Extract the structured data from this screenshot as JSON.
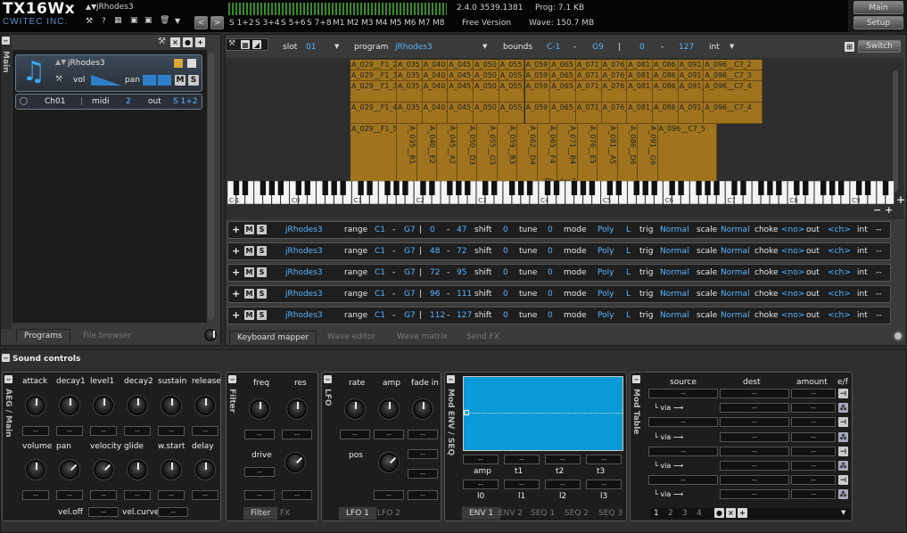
{
  "app": {
    "title": "TX16Wx",
    "vendor": "CWITEC INC.",
    "program_name": "jRhodes3",
    "version": "2.4.0 3539.1381",
    "prog_mem": "Prog: 7.1 KB",
    "license": "Free Version",
    "wave_mem": "Wave: 150.7 MB"
  },
  "top_buttons": {
    "main": "Main",
    "setup": "Setup"
  },
  "outputs": [
    "S 1+2",
    "S 3+4",
    "S 5+6",
    "S 7+8",
    "M1",
    "M2",
    "M3",
    "M4",
    "M5",
    "M6",
    "M7",
    "M8"
  ],
  "icons": {
    "prev": "<",
    "next": ">",
    "wrench": "wrench-icon",
    "help": "?",
    "grid": "grid-icon",
    "save": "save-icon",
    "trash": "trash-icon"
  },
  "programs_panel": {
    "side_label": "Main",
    "header_buttons": [
      "×",
      "●",
      "+"
    ],
    "program": {
      "name": "jRhodes3",
      "vol_label": "vol",
      "pan_label": "pan",
      "mute": "M",
      "solo": "S"
    },
    "channel": {
      "ch": "Ch01",
      "midi_label": "midi",
      "midi_val": "2",
      "out_label": "out",
      "out_val": "S 1+2"
    },
    "tabs": [
      "Programs",
      "File browser"
    ]
  },
  "mapper": {
    "slot_label": "slot",
    "slot_val": "01",
    "program_label": "program",
    "program_val": "jRhodes3",
    "bounds_label": "bounds",
    "bounds_lo": "C-1",
    "bounds_hi": "G9",
    "vel_lo": "0",
    "vel_hi": "127",
    "int_label": "int",
    "switch_label": "Switch",
    "dash": "-",
    "sep": "|",
    "rows": [
      [
        "A_029__F1_2",
        "A_035_",
        "A_040_",
        "A_045_",
        "A_050_",
        "A_055_",
        "A_059_",
        "A_065_",
        "A_071_",
        "A_076_",
        "A_081_",
        "A_086_",
        "A_091_",
        "A_096__C7_2"
      ],
      [
        "A_029__F1_3",
        "A_035_",
        "A_040_",
        "A_045_",
        "A_050_",
        "A_055_",
        "A_059_",
        "A_065_",
        "A_071_",
        "A_076_",
        "A_081_",
        "A_086_",
        "A_091_",
        "A_096__C7_3"
      ],
      [
        "A_029__F1_3",
        "A_035_",
        "A_040_",
        "A_045_",
        "A_050_",
        "A_055_",
        "A_059_",
        "A_065_",
        "A_071_",
        "A_076_",
        "A_081_",
        "A_086_",
        "A_091_",
        "A_096__C7_4"
      ],
      [
        "A_029__F1_4",
        "A_035_",
        "A_040_",
        "A_045_",
        "A_050_",
        "A_055_",
        "A_059_",
        "A_065_",
        "A_071_",
        "A_076_",
        "A_081_",
        "A_086_",
        "A_091_",
        "A_096__C7_4"
      ],
      [
        "A_029__F1_5",
        "A_035__B1",
        "A_040__E2",
        "A_045__A2",
        "A_050__D3",
        "A_055__G3",
        "A_059__B3",
        "A_062__D4",
        "A_065__F4",
        "A_071__B4",
        "A_076__E5",
        "A_081__A5",
        "A_086__D6",
        "A_091__G6",
        "A_096__C7_5"
      ]
    ],
    "middle_tag": "jRhodes3",
    "octaves": [
      "C-1",
      "C0",
      "C1",
      "C2",
      "C3",
      "C4",
      "C5",
      "C6",
      "C7",
      "C8",
      "C9"
    ],
    "tabs": [
      "Keyboard mapper",
      "Wave editor",
      "Wave matrix",
      "Send FX"
    ]
  },
  "layers": [
    {
      "name": "jRhodes3",
      "range_lo": "C1",
      "range_hi": "G7",
      "vel_lo": "0",
      "vel_hi": "47",
      "shift": "0",
      "tune": "0",
      "mode": "Poly",
      "pan": "L",
      "trig": "Normal",
      "scale": "Normal",
      "choke": "<no>",
      "out": "<ch>",
      "int": "--"
    },
    {
      "name": "jRhodes3",
      "range_lo": "C1",
      "range_hi": "G7",
      "vel_lo": "48",
      "vel_hi": "72",
      "shift": "0",
      "tune": "0",
      "mode": "Poly",
      "pan": "L",
      "trig": "Normal",
      "scale": "Normal",
      "choke": "<no>",
      "out": "<ch>",
      "int": "--"
    },
    {
      "name": "jRhodes3",
      "range_lo": "C1",
      "range_hi": "G7",
      "vel_lo": "72",
      "vel_hi": "95",
      "shift": "0",
      "tune": "0",
      "mode": "Poly",
      "pan": "L",
      "trig": "Normal",
      "scale": "Normal",
      "choke": "<no>",
      "out": "<ch>",
      "int": "--"
    },
    {
      "name": "jRhodes3",
      "range_lo": "C1",
      "range_hi": "G7",
      "vel_lo": "96",
      "vel_hi": "111",
      "shift": "0",
      "tune": "0",
      "mode": "Poly",
      "pan": "L",
      "trig": "Normal",
      "scale": "Normal",
      "choke": "<no>",
      "out": "<ch>",
      "int": "--"
    },
    {
      "name": "jRhodes3",
      "range_lo": "C1",
      "range_hi": "G7",
      "vel_lo": "112",
      "vel_hi": "127",
      "shift": "0",
      "tune": "0",
      "mode": "Poly",
      "pan": "L",
      "trig": "Normal",
      "scale": "Normal",
      "choke": "<no>",
      "out": "<ch>",
      "int": "--"
    }
  ],
  "layer_labels": {
    "range": "range",
    "shift": "shift",
    "tune": "tune",
    "mode": "mode",
    "trig": "trig",
    "scale": "scale",
    "choke": "choke",
    "out": "out",
    "int": "int",
    "dash": "-",
    "sep": "|",
    "mute": "M",
    "solo": "S"
  },
  "sound": {
    "title": "Sound controls",
    "aeg_label": "AEG / Main",
    "aeg_top": [
      "attack",
      "decay1",
      "level1",
      "decay2",
      "sustain",
      "release"
    ],
    "aeg_bottom": [
      "volume",
      "pan",
      "velocity",
      "glide",
      "w.start",
      "delay"
    ],
    "vel_off": "vel.off",
    "vel_curve": "vel.curve",
    "filter_label": "Filter",
    "filter_knobs": [
      "freq",
      "res"
    ],
    "drive": "drive",
    "filter_tabs": [
      "Filter",
      "FX"
    ],
    "lfo_label": "LFO",
    "lfo_knobs": [
      "rate",
      "amp",
      "fade in"
    ],
    "pos": "pos",
    "lfo_tabs": [
      "LFO 1",
      "LFO 2"
    ],
    "env_label": "Mod ENV / SEQ",
    "env_top": [
      "amp",
      "t1",
      "t2",
      "t3"
    ],
    "env_bottom": [
      "l0",
      "l1",
      "l2",
      "l3"
    ],
    "env_tabs": [
      "ENV 1",
      "ENV 2",
      "SEQ 1",
      "SEQ 2",
      "SEQ 3"
    ],
    "mod_label": "Mod Table",
    "mod_headers": [
      "source",
      "dest",
      "amount",
      "e/f"
    ],
    "via": "└ via ⟶",
    "mod_pages": [
      "1",
      "2",
      "3",
      "4"
    ],
    "dash": "--"
  },
  "colors": {
    "accent_blue": "#5ab4ff",
    "zone_orange": "#a0741e",
    "env_blue": "#0a9ad8"
  }
}
